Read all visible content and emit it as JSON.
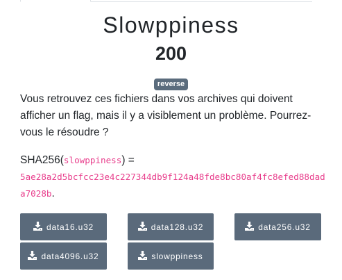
{
  "challenge": {
    "title": "Slowppiness",
    "points": "200",
    "tag": "reverse",
    "description": "Vous retrouvez ces fichiers dans vos archives qui doivent afficher un flag, mais il y a visiblement un problème. Pourrez-vous le résoudre ?",
    "sha_prefix": "SHA256(",
    "sha_filename": "slowppiness",
    "sha_suffix": ") =",
    "sha_hash": "5ae28a2d5bcfcc23e4c227344db9f124a48fde8bc80af4fc8efed88dada7028b",
    "sha_period": "."
  },
  "files": [
    {
      "label": "data16.u32",
      "icon": "download-icon"
    },
    {
      "label": "data128.u32",
      "icon": "download-icon"
    },
    {
      "label": "data256.u32",
      "icon": "download-icon"
    },
    {
      "label": "data4096.u32",
      "icon": "download-icon"
    },
    {
      "label": "slowppiness",
      "icon": "download-icon"
    }
  ],
  "colors": {
    "button_bg": "#5a6a7b",
    "badge_bg": "#5b6c7d",
    "code": "#e83e8c"
  }
}
